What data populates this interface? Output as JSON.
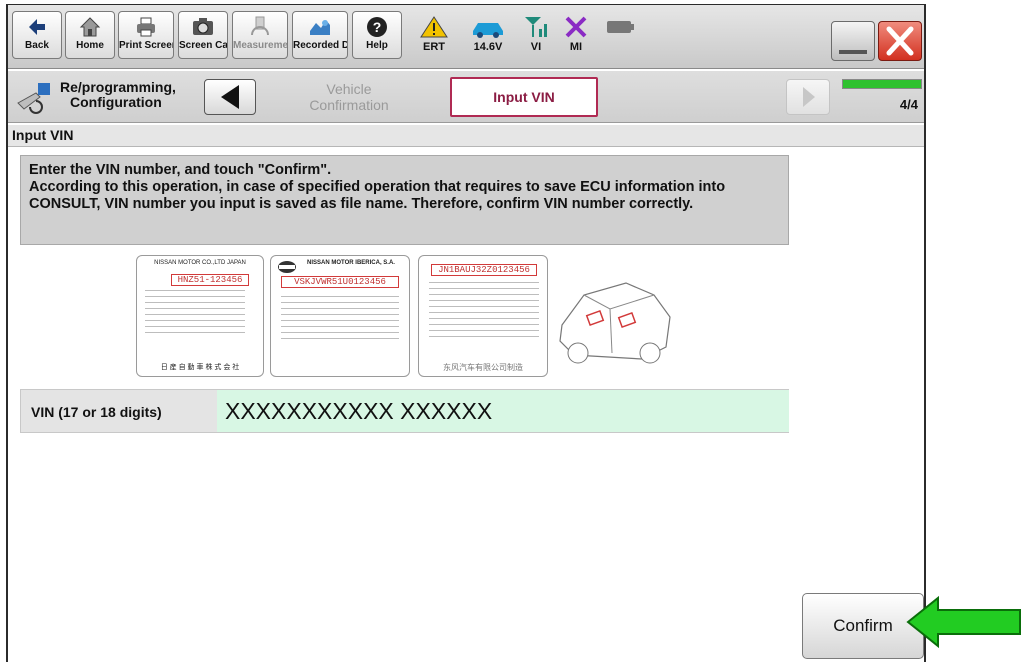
{
  "toolbar": {
    "buttons": [
      {
        "label": "Back",
        "icon": "back-arrow-icon"
      },
      {
        "label": "Home",
        "icon": "home-icon"
      },
      {
        "label": "Print Screen",
        "icon": "printer-icon"
      },
      {
        "label": "Screen Capture",
        "icon": "camera-icon"
      },
      {
        "label": "Measurement Mode",
        "icon": "gauge-icon"
      },
      {
        "label": "Recorded Data",
        "icon": "recorded-data-icon"
      },
      {
        "label": "Help",
        "icon": "help-icon"
      }
    ],
    "status": [
      {
        "label": "ERT",
        "icon": "warning-icon"
      },
      {
        "label": "14.6V",
        "icon": "car-battery-icon"
      },
      {
        "label": "VI",
        "icon": "signal-icon"
      },
      {
        "label": "MI",
        "icon": "x-mark-icon"
      },
      {
        "label": "",
        "icon": "battery-icon"
      }
    ]
  },
  "breadcrumb": {
    "title_line1": "Re/programming,",
    "title_line2": "Configuration",
    "step_previous_line1": "Vehicle",
    "step_previous_line2": "Confirmation",
    "step_current": "Input VIN",
    "step_counter": "4/4",
    "progress_fraction": 1.0
  },
  "section_header": "Input VIN",
  "instruction": {
    "line1": "Enter the VIN number, and touch \"Confirm\".",
    "line2": "According to this operation, in case of specified operation that requires to save ECU information into CONSULT, VIN number you input is saved as file name. Therefore, confirm VIN number correctly."
  },
  "illustration": {
    "plate1_header": "NISSAN MOTOR CO.,LTD JAPAN",
    "plate1_vin": "HNZ51-123456",
    "plate1_footer": "日 産 自 動 車 株 式 会 社",
    "plate2_header": "NISSAN MOTOR IBERICA, S.A.",
    "plate2_vin": "VSKJVWR51U0123456",
    "plate3_vin": "JN1BAUJ32Z0123456",
    "plate3_footer": "东风汽车有限公司制造"
  },
  "vin": {
    "label": "VIN (17 or 18 digits)",
    "value": "XXXXXXXXXXX XXXXXX"
  },
  "confirm_label": "Confirm",
  "colors": {
    "accent_tab": "#b02a53",
    "vin_field": "#d8f7e4",
    "progress": "#2fc12f",
    "arrow": "#22cc22",
    "close": "#d2301f"
  }
}
